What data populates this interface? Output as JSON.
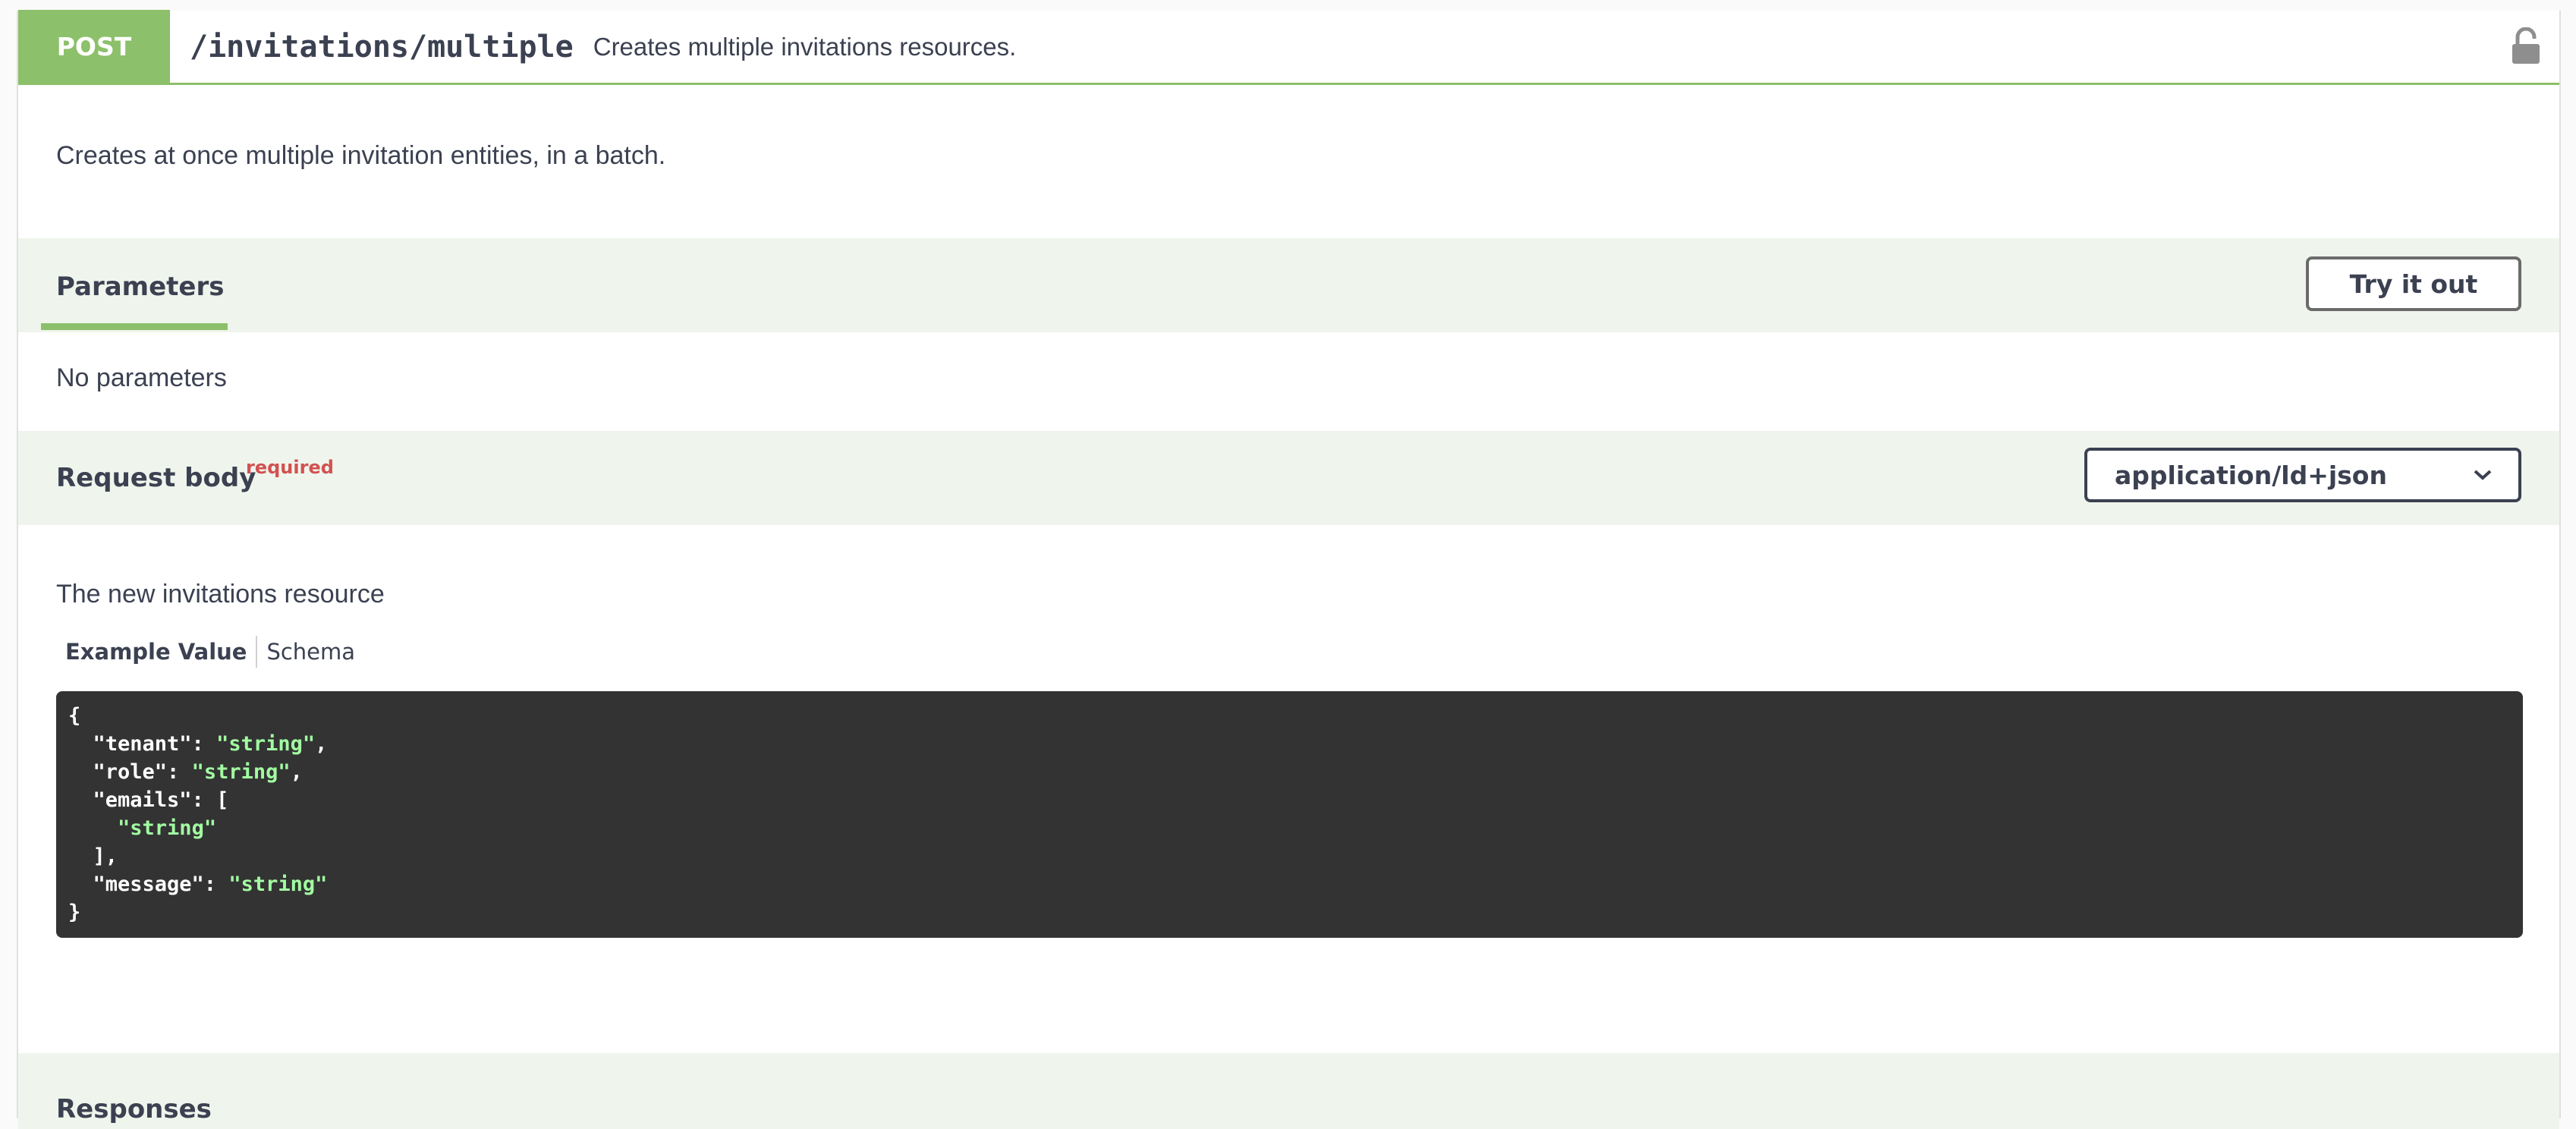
{
  "operation": {
    "method": "POST",
    "path": "/invitations/multiple",
    "summary": "Creates multiple invitations resources.",
    "description": "Creates at once multiple invitation entities, in a batch.",
    "lock_icon": "lock-icon",
    "method_color": "#8cc06a"
  },
  "parameters": {
    "title": "Parameters",
    "try_label": "Try it out",
    "empty_text": "No parameters"
  },
  "request_body": {
    "title": "Request body",
    "required_label": "required",
    "content_type": "application/ld+json",
    "description": "The new invitations resource",
    "tabs": [
      "Example Value",
      "Schema"
    ],
    "example": {
      "l1": "{",
      "tenant_key": "  \"tenant\": ",
      "tenant_val": "\"string\"",
      "role_key": "  \"role\": ",
      "role_val": "\"string\"",
      "emails_key": "  \"emails\": [",
      "emails_item": "\"string\"",
      "emails_close": "  ],",
      "message_key": "  \"message\": ",
      "message_val": "\"string\"",
      "l_end": "}"
    }
  },
  "responses": {
    "title": "Responses"
  }
}
